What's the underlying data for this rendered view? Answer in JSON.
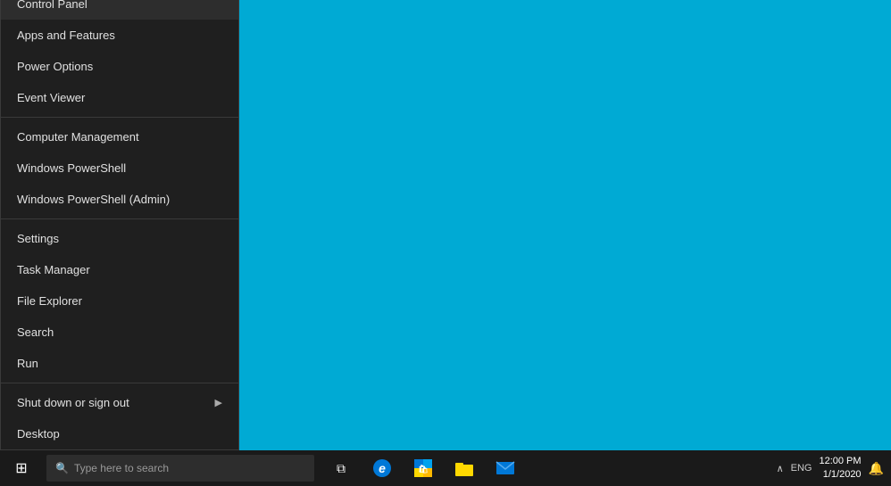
{
  "menu": {
    "items": [
      {
        "id": "control-panel",
        "label": "Control Panel",
        "highlighted": true,
        "divider_after": false
      },
      {
        "id": "apps-features",
        "label": "Apps and Features",
        "highlighted": false,
        "divider_after": false
      },
      {
        "id": "power-options",
        "label": "Power Options",
        "highlighted": false,
        "divider_after": false
      },
      {
        "id": "event-viewer",
        "label": "Event Viewer",
        "highlighted": false,
        "divider_after": true
      },
      {
        "id": "computer-management",
        "label": "Computer Management",
        "highlighted": false,
        "divider_after": false
      },
      {
        "id": "windows-powershell",
        "label": "Windows PowerShell",
        "highlighted": false,
        "divider_after": false
      },
      {
        "id": "windows-powershell-admin",
        "label": "Windows PowerShell (Admin)",
        "highlighted": false,
        "divider_after": true
      },
      {
        "id": "settings",
        "label": "Settings",
        "highlighted": false,
        "divider_after": false
      },
      {
        "id": "task-manager",
        "label": "Task Manager",
        "highlighted": false,
        "divider_after": false
      },
      {
        "id": "file-explorer",
        "label": "File Explorer",
        "highlighted": false,
        "divider_after": false
      },
      {
        "id": "search",
        "label": "Search",
        "highlighted": false,
        "divider_after": false
      },
      {
        "id": "run",
        "label": "Run",
        "highlighted": false,
        "divider_after": true
      },
      {
        "id": "shut-down",
        "label": "Shut down or sign out",
        "highlighted": false,
        "has_arrow": true,
        "divider_after": false
      },
      {
        "id": "desktop",
        "label": "Desktop",
        "highlighted": false,
        "divider_after": false
      }
    ]
  },
  "taskbar": {
    "start_icon": "⊞",
    "search_placeholder": "Type here to search",
    "time": "12:00 PM",
    "date": "1/1/2020"
  }
}
